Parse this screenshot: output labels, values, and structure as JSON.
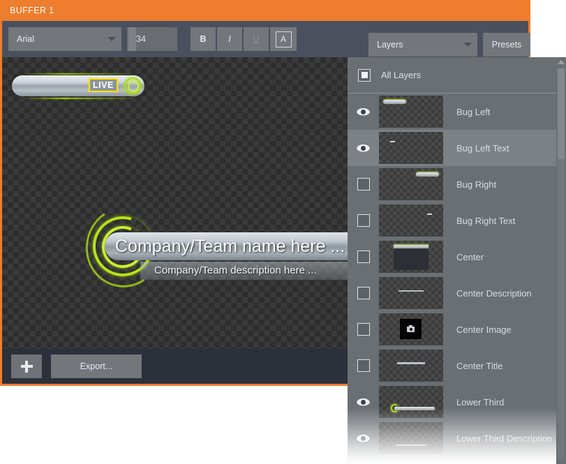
{
  "window": {
    "title": "BUFFER 1",
    "accent_color": "#ef7d2e",
    "chrome_color": "#2b303b",
    "toolbar_color": "#4a505e"
  },
  "toolbar": {
    "font_family_value": "Arial",
    "font_family_caret": "chevron-down-icon",
    "font_size_value": "34",
    "bold_label": "B",
    "italic_label": "I",
    "underline_label": "U",
    "text_color_label": "A"
  },
  "canvas": {
    "bug_left": {
      "badge_label": "LIVE",
      "badge_border_color": "#ffe600",
      "glow_color": "#b5e309"
    },
    "lower_third": {
      "title": "Company/Team name here ...",
      "description": "Company/Team description here ...",
      "accent_color": "#b6e314"
    }
  },
  "bottom_bar": {
    "add_label": "+",
    "export_label": "Export..."
  },
  "layers_panel": {
    "selector_value": "Layers",
    "selector_caret": "chevron-down-icon",
    "presets_label": "Presets",
    "all_layers_label": "All Layers",
    "all_layers_checked": true,
    "scrollbar_up_icon": "triangle-up-icon",
    "layers": [
      {
        "name": "Bug Left",
        "visible": true,
        "selected": false,
        "thumb": "pill-left"
      },
      {
        "name": "Bug Left Text",
        "visible": true,
        "selected": true,
        "thumb": "dot-left"
      },
      {
        "name": "Bug Right",
        "visible": false,
        "selected": false,
        "thumb": "pill-right"
      },
      {
        "name": "Bug Right Text",
        "visible": false,
        "selected": false,
        "thumb": "dot-right"
      },
      {
        "name": "Center",
        "visible": false,
        "selected": false,
        "thumb": "center-box"
      },
      {
        "name": "Center Description",
        "visible": false,
        "selected": false,
        "thumb": "line-desc"
      },
      {
        "name": "Center Image",
        "visible": false,
        "selected": false,
        "thumb": "image-box"
      },
      {
        "name": "Center Title",
        "visible": false,
        "selected": false,
        "thumb": "line-title"
      },
      {
        "name": "Lower Third",
        "visible": true,
        "selected": false,
        "thumb": "lower-third"
      },
      {
        "name": "Lower Third Description",
        "visible": true,
        "selected": false,
        "thumb": "line-lt-desc"
      }
    ]
  }
}
